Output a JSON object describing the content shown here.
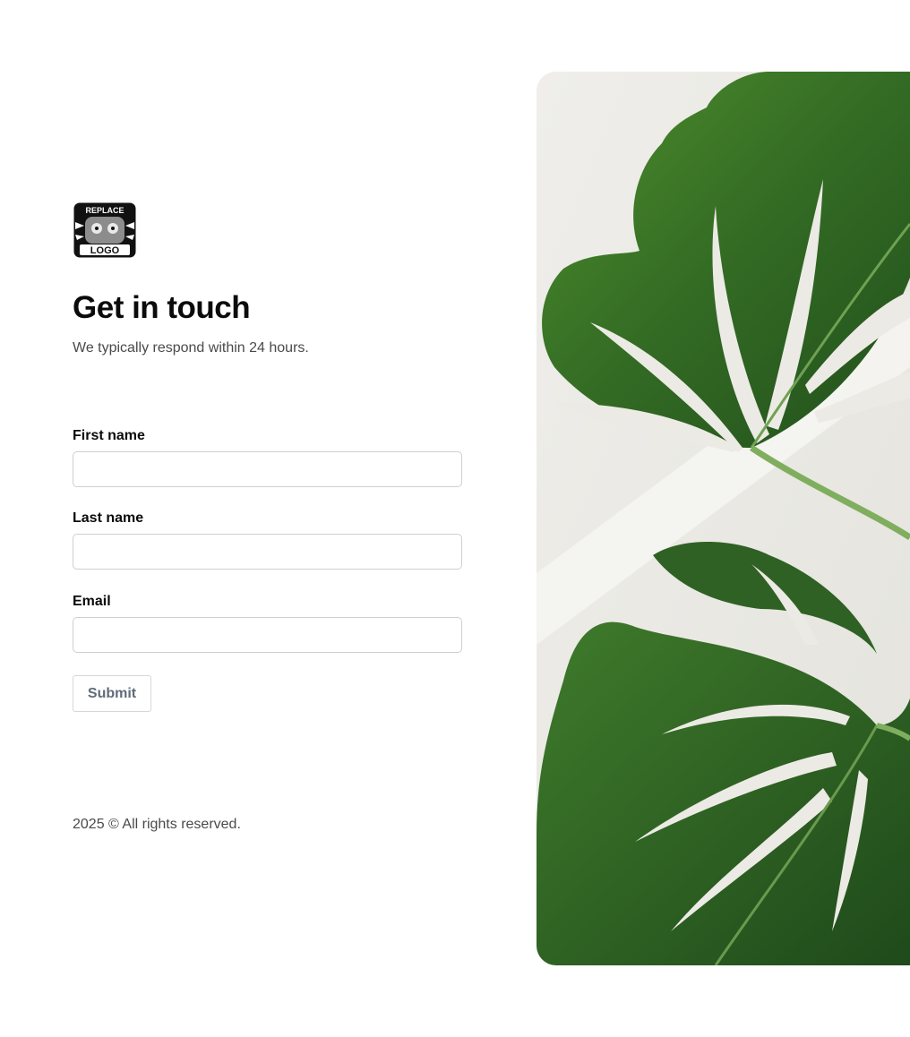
{
  "logo": {
    "top_text": "REPLACE",
    "bottom_text": "LOGO"
  },
  "header": {
    "title": "Get in touch",
    "subtitle": "We typically respond within 24 hours."
  },
  "form": {
    "first_name": {
      "label": "First name",
      "value": "",
      "placeholder": ""
    },
    "last_name": {
      "label": "Last name",
      "value": "",
      "placeholder": ""
    },
    "email": {
      "label": "Email",
      "value": "",
      "placeholder": ""
    },
    "submit_label": "Submit"
  },
  "footer": {
    "copyright": "2025 © All rights reserved."
  },
  "photo": {
    "subject": "monstera-leaves",
    "colors": {
      "background": "#ecebe6",
      "leaf_dark": "#2a5a24",
      "leaf_mid": "#3e7a2c",
      "leaf_light": "#5f9a3a",
      "stem": "#7fae5e"
    }
  },
  "colors": {
    "title": "#0b0b0b",
    "muted_text": "#4a4a4a",
    "input_border": "#cfcfcf",
    "button_text": "#5f6b7a"
  }
}
